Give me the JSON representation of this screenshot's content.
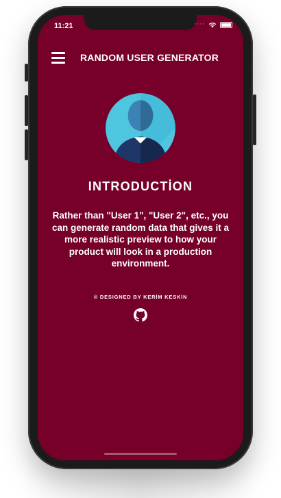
{
  "status_bar": {
    "time": "11:21",
    "signal_dots": "····",
    "wifi_icon": "wifi-icon",
    "battery_icon": "battery-icon"
  },
  "app_bar": {
    "menu_icon": "hamburger-menu-icon",
    "title": "RANDOM USER GENERATOR"
  },
  "content": {
    "avatar_icon": "user-avatar-icon",
    "section_title": "INTRODUCTİON",
    "intro_text": "Rather than \"User 1\", \"User 2\", etc., you can generate random data that gives it a more realistic preview to how your product will look in a production environment.",
    "credit": "© DESIGNED BY KERİM KESKİN",
    "github_icon": "github-icon"
  },
  "colors": {
    "screen_background": "#760029",
    "text": "#ffffff",
    "avatar_circle": "#4fc6e0",
    "avatar_head": "#2f6b96",
    "avatar_body": "#1e3766"
  }
}
